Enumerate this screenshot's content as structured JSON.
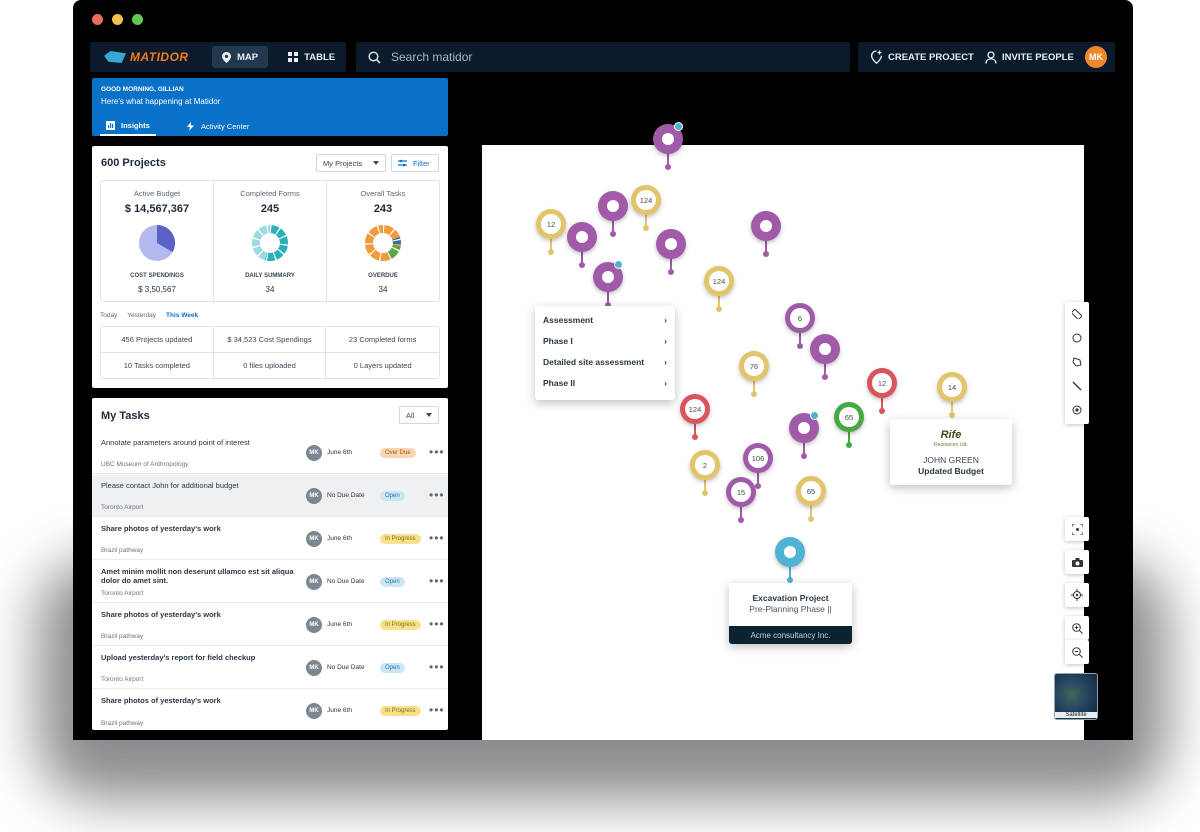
{
  "app": {
    "brand": "MATIDOR",
    "colors": {
      "accent": "#0a71c8",
      "brand_orange": "#f07c1c"
    }
  },
  "nav": {
    "map_label": "MAP",
    "table_label": "TABLE",
    "active": "MAP"
  },
  "search": {
    "placeholder": "Search matidor"
  },
  "actions": {
    "create_project": "CREATE PROJECT",
    "invite_people": "INVITE PEOPLE",
    "user_initials": "MK"
  },
  "greeting": {
    "hello": "GOOD MORNING, GILLIAN",
    "subtitle": "Here's what happening at Matidor",
    "tabs": [
      "Insights",
      "Activity Center"
    ]
  },
  "projects": {
    "title": "600 Projects",
    "scope_select": "My Projects",
    "filter_label": "Filter",
    "stats": [
      {
        "label": "Active Budget",
        "value": "$ 14,567,367",
        "sub_label": "COST SPENDINGS",
        "sub_value": "$ 3,50,567",
        "chart_icon": "pie-chart"
      },
      {
        "label": "Completed Forms",
        "value": "245",
        "sub_label": "DAILY SUMMARY",
        "sub_value": "34",
        "chart_icon": "donut-teal"
      },
      {
        "label": "Overall Tasks",
        "value": "243",
        "sub_label": "OVERDUE",
        "sub_value": "34",
        "chart_icon": "donut-orange"
      }
    ],
    "periods": [
      "Today",
      "Yesterday",
      "This Week"
    ],
    "active_period": "This Week",
    "summary": [
      "456 Projects updated",
      "$ 34,523 Cost Spendings",
      "23 Completed forms",
      "10 Tasks completed",
      "0 files uploaded",
      "0 Layers updated"
    ]
  },
  "tasks": {
    "title": "My Tasks",
    "filter": "All",
    "rows": [
      {
        "name": "Annotate parameters around point of interest",
        "location": "UBC Museum of Anthropology",
        "assignee": "MK",
        "due": "June 6th",
        "status": "Over Due",
        "status_kind": "overdue"
      },
      {
        "name": "Please contact John for additional budget",
        "location": "Toronto Airport",
        "assignee": "MK",
        "due": "No Due Date",
        "status": "Open",
        "status_kind": "open"
      },
      {
        "name": "Share photos of yesterday's work",
        "location": "Brazil pathway",
        "assignee": "MK",
        "due": "June 6th",
        "status": "In Progress",
        "status_kind": "progress"
      },
      {
        "name": "Amet minim mollit non deserunt ullamco est sit aliqua dolor do amet sint.",
        "location": "Toronto Airport",
        "assignee": "MK",
        "due": "No Due Date",
        "status": "Open",
        "status_kind": "open"
      },
      {
        "name": "Share photos of yesterday's work",
        "location": "Brazil pathway",
        "assignee": "MK",
        "due": "June 6th",
        "status": "In Progress",
        "status_kind": "progress"
      },
      {
        "name": "Upload yesterday's report for field checkup",
        "location": "Toronto Airport",
        "assignee": "MK",
        "due": "No Due Date",
        "status": "Open",
        "status_kind": "open"
      },
      {
        "name": "Share photos of yesterday's work",
        "location": "Brazil pathway",
        "assignee": "MK",
        "due": "June 6th",
        "status": "In Progress",
        "status_kind": "progress"
      }
    ]
  },
  "map": {
    "pin_labels": [
      "12",
      "124",
      "124",
      "6",
      "76",
      "12",
      "14",
      "124",
      "65",
      "2",
      "106",
      "15",
      "65"
    ],
    "context_menu": [
      "Assessment",
      "Phase I",
      "Detailed site assessment",
      "Phase II"
    ],
    "rife_card": {
      "logo_text": "Rife",
      "logo_sub": "Resources Ltd.",
      "name": "JOHN GREEN",
      "subtitle": "Updated Budget"
    },
    "excavation_card": {
      "title": "Excavation Project",
      "phase": "Pre-Planning Phase ||",
      "company": "Acme consultancy Inc."
    },
    "basemap_label": "Satellite",
    "tools": [
      "ruler-icon",
      "circle-icon",
      "polygon-icon",
      "line-icon",
      "point-icon"
    ],
    "controls": [
      "fit-extent-icon",
      "camera-icon",
      "locate-icon",
      "zoom-in-icon",
      "zoom-out-icon"
    ]
  }
}
